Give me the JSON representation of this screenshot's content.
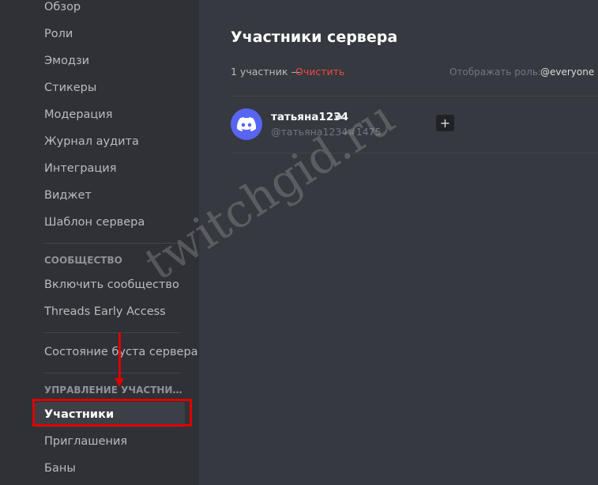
{
  "sidebar": {
    "items_top": [
      "Обзор",
      "Роли",
      "Эмодзи",
      "Стикеры",
      "Модерация",
      "Журнал аудита",
      "Интеграция",
      "Виджет",
      "Шаблон сервера"
    ],
    "community_header": "СООБЩЕСТВО",
    "community_items": [
      "Включить сообщество",
      "Threads Early Access"
    ],
    "boost_item": "Состояние буста сервера",
    "members_header": "УПРАВЛЕНИЕ УЧАСТНИКА...",
    "members_items": [
      "Участники",
      "Приглашения",
      "Баны"
    ],
    "active_item": "Участники"
  },
  "main": {
    "title": "Участники сервера",
    "member_count": "1 участник —",
    "clear_label": "Очистить",
    "role_filter_label": "Отображать роль:",
    "role_filter_value": "@everyone"
  },
  "members": [
    {
      "username": "татьяна1234",
      "tag": "@татьяна1234#1475",
      "is_owner": true,
      "avatar_icon": "discord-logo-icon"
    }
  ],
  "watermark": "twitchgid.ru",
  "colors": {
    "accent": "#5865f2",
    "danger": "#f04747",
    "highlight": "#e00000"
  }
}
